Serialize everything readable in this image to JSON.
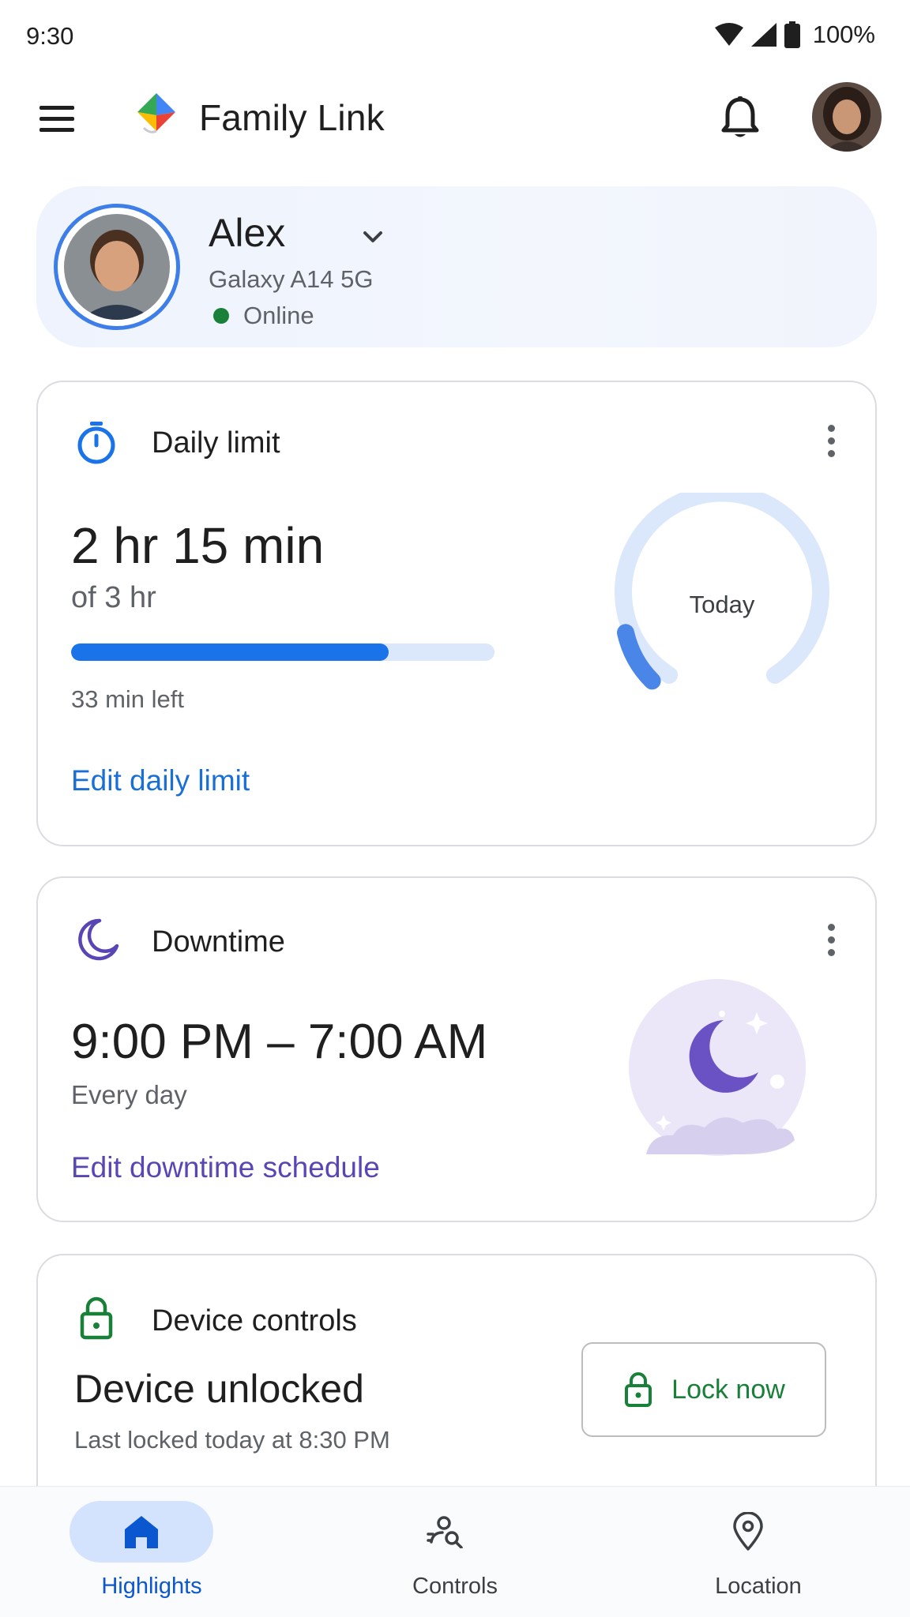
{
  "status_bar": {
    "time": "9:30",
    "battery": "100%"
  },
  "app_bar": {
    "title": "Family Link"
  },
  "child": {
    "name": "Alex",
    "device": "Galaxy A14 5G",
    "status": "Online"
  },
  "daily_limit": {
    "title": "Daily limit",
    "used": "2 hr 15 min",
    "of_total": "of 3 hr",
    "progress_fraction": 0.75,
    "remaining": "33 min left",
    "ring_label": "Today",
    "ring_fraction": 0.12,
    "edit_link": "Edit daily limit",
    "accent": "#1a73e8"
  },
  "downtime": {
    "title": "Downtime",
    "schedule": "9:00 PM – 7:00 AM",
    "repeat": "Every day",
    "edit_link": "Edit downtime schedule",
    "accent": "#5a45b5"
  },
  "device_controls": {
    "title": "Device controls",
    "state": "Device unlocked",
    "last_locked": "Last locked today at 8:30 PM",
    "lock_button": "Lock now",
    "accent": "#188038"
  },
  "bottom_nav": {
    "items": [
      {
        "label": "Highlights",
        "icon": "home-icon",
        "active": true
      },
      {
        "label": "Controls",
        "icon": "controls-icon",
        "active": false
      },
      {
        "label": "Location",
        "icon": "location-pin-icon",
        "active": false
      }
    ]
  }
}
